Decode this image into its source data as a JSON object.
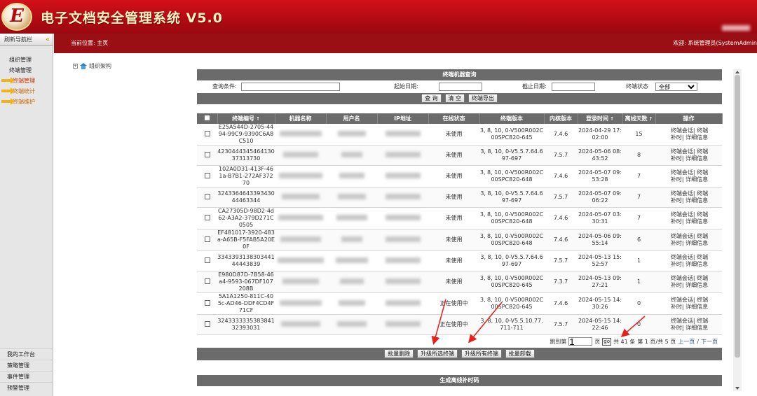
{
  "app": {
    "title": "电子文档安全管理系统 V5.0",
    "logo_letter": "E"
  },
  "sidebar": {
    "header": "刷新导航栏",
    "collapse_glyph": "«",
    "items": [
      {
        "label": "组织管理"
      },
      {
        "label": "终端管理"
      },
      {
        "label": "终端管理"
      },
      {
        "label": "终端统计"
      },
      {
        "label": "终端维护"
      }
    ],
    "bottom_items": [
      {
        "label": "我的工作台"
      },
      {
        "label": "策略管理"
      },
      {
        "label": "事件管理"
      },
      {
        "label": "预警管理"
      }
    ]
  },
  "topbar": {
    "breadcrumb": "当前位置: 主页",
    "welcome": "欢迎: 系统管理员(SystemAdmin"
  },
  "tree": {
    "plus": "+",
    "root": "组织架构"
  },
  "query": {
    "title": "终端机器查询",
    "condition_label": "查询条件:",
    "start_label": "起始日期:",
    "end_label": "截止日期:",
    "status_label": "终端状态",
    "status_value": "全部",
    "btn_query": "查 询",
    "btn_clear": "清 空",
    "btn_export": "终端导出"
  },
  "table": {
    "columns": [
      "终端编号",
      "机器名称",
      "用户名",
      "IP地址",
      "在线状态",
      "终端版本",
      "内核版本",
      "登录时间",
      "离线天数",
      "操作"
    ],
    "sort_glyph": "↑",
    "op_session": "终端会话| 终端",
    "op_patch": "补时| 详细信息",
    "rows": [
      {
        "id": "E25A544D-2705-4494-99C9-9390C6A8C510",
        "status": "未使用",
        "version": "3, 8, 10, 0-V500R002C00SPC820-645",
        "kernel": "7.4.6",
        "login": "2024-04-29 17:02:00",
        "days": "15"
      },
      {
        "id": "423044434546413037313730",
        "status": "未使用",
        "version": "3, 8, 10, 0-V5.5.7.64.697-697",
        "kernel": "7.5.7",
        "login": "2024-05-06 08:43:52",
        "days": "8"
      },
      {
        "id": "102A0D31-413F-461a-B7B1-272AF37270",
        "status": "未使用",
        "version": "3, 8, 10, 0-V500R002C00SPC820-648",
        "kernel": "7.4.6",
        "login": "2024-05-07 09:53:28",
        "days": "7"
      },
      {
        "id": "324336464339343044463344",
        "status": "未使用",
        "version": "3, 8, 10, 0-V5.5.7.64.697-697",
        "kernel": "7.5.7",
        "login": "2024-05-07 09:06:22",
        "days": "7"
      },
      {
        "id": "CA27305D-98D2-4d62-A3A2-379D271C0505",
        "status": "未使用",
        "version": "3, 8, 10, 0-V500R002C00SPC820-648",
        "kernel": "7.4.6",
        "login": "2024-05-07 03:30:31",
        "days": "7"
      },
      {
        "id": "EF481017-3920-483a-A65B-F5FAB5A20E0F",
        "status": "未使用",
        "version": "3, 8, 10, 0-V500R002C00SPC820-648",
        "kernel": "7.4.6",
        "login": "2024-05-06 09:55:14",
        "days": "6"
      },
      {
        "id": "334339313830344144443839",
        "status": "未使用",
        "version": "3, 8, 10, 0-V5.5.7.64.697-697",
        "kernel": "7.5.7",
        "login": "2024-05-13 15:52:57",
        "days": "1"
      },
      {
        "id": "E980D87D-7B58-46a4-9593-067DF107208B",
        "status": "未使用",
        "version": "3, 8, 10, 0-V500R002C00SPC820-645",
        "kernel": "7.3.7",
        "login": "2024-05-13 09:27:21",
        "days": "1"
      },
      {
        "id": "5A1A1250-811C-405c-AD46-DDF4CD4F71CF",
        "status": "正在使用中",
        "version": "3, 8, 10, 0-V500R002C00SPC820-645",
        "kernel": "7.4.6",
        "login": "2024-05-15 14:30:26",
        "days": "0"
      },
      {
        "id": "324333333538384132393031",
        "status": "正在使用中",
        "version": "3, 8, 10, 0-V5.5.10.77.711-711",
        "kernel": "7.5.7",
        "login": "2024-05-15 14:22:46",
        "days": "0"
      }
    ]
  },
  "pager": {
    "jump_label": "跳到第",
    "page_input": "1",
    "page_unit": "页",
    "go": "go",
    "total": "共 41 条",
    "page_of": "第 1 页/共 5 页",
    "prev": "上一页",
    "sep": "/",
    "next": "下一页"
  },
  "actions": {
    "batch_delete": "批量删除",
    "upgrade_selected": "升级所选终端",
    "upgrade_all": "升级所有终端",
    "batch_uninstall": "批量卸载"
  },
  "bottom_section": {
    "title": "生成离线补时码"
  },
  "colors": {
    "header_red": "#c00c14",
    "topbar_red": "#9a0f14",
    "bar_gray": "#6b6b6b",
    "op_link": "#b8351c",
    "annotation": "#e8201c"
  }
}
